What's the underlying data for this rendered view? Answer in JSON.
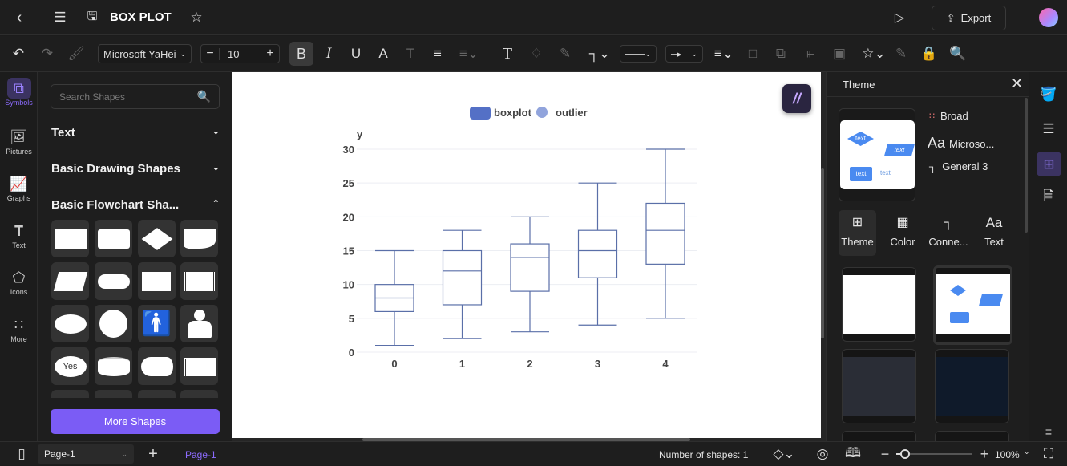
{
  "header": {
    "title": "BOX PLOT",
    "export_label": "Export"
  },
  "toolbar": {
    "font": "Microsoft YaHei",
    "font_size": "10"
  },
  "rail": {
    "items": [
      {
        "label": "Symbols",
        "icon": "symbols-icon"
      },
      {
        "label": "Pictures",
        "icon": "picture-icon"
      },
      {
        "label": "Graphs",
        "icon": "graph-icon"
      },
      {
        "label": "Text",
        "icon": "text-icon"
      },
      {
        "label": "Icons",
        "icon": "icons-icon"
      },
      {
        "label": "More",
        "icon": "grid-dots-icon"
      }
    ]
  },
  "panel": {
    "search_placeholder": "Search Shapes",
    "sections": [
      "Text",
      "Basic Drawing Shapes",
      "Basic Flowchart Sha..."
    ],
    "yes_label": "Yes",
    "more_shapes": "More Shapes"
  },
  "theme_panel": {
    "title": "Theme",
    "color_scheme": "Broad",
    "font": "Microso...",
    "connector": "General 3",
    "aa": "Aa",
    "tabs": [
      "Theme",
      "Color",
      "Conne...",
      "Text"
    ],
    "thumb_text": "text"
  },
  "status": {
    "page_select": "Page-1",
    "page_tab": "Page-1",
    "shape_count": "Number of shapes: 1",
    "zoom": "100%"
  },
  "colors": {
    "accent": "#7b5cf5",
    "box": "#5470c6",
    "outlier": "#91a4dc"
  },
  "chart_data": {
    "type": "boxplot",
    "legend": [
      "boxplot",
      "outlier"
    ],
    "legend_placement": "top",
    "ylabel": "y",
    "categories": [
      "0",
      "1",
      "2",
      "3",
      "4"
    ],
    "yticks": [
      "0",
      "5",
      "10",
      "15",
      "20",
      "25",
      "30"
    ],
    "ylim": [
      0,
      30
    ],
    "grid": true,
    "boxes": [
      {
        "min": 1,
        "q1": 6,
        "median": 8,
        "q3": 10,
        "max": 15
      },
      {
        "min": 2,
        "q1": 7,
        "median": 12,
        "q3": 15,
        "max": 18
      },
      {
        "min": 3,
        "q1": 9,
        "median": 14,
        "q3": 16,
        "max": 20
      },
      {
        "min": 4,
        "q1": 11,
        "median": 15,
        "q3": 18,
        "max": 25
      },
      {
        "min": 5,
        "q1": 13,
        "median": 18,
        "q3": 22,
        "max": 30
      }
    ]
  }
}
